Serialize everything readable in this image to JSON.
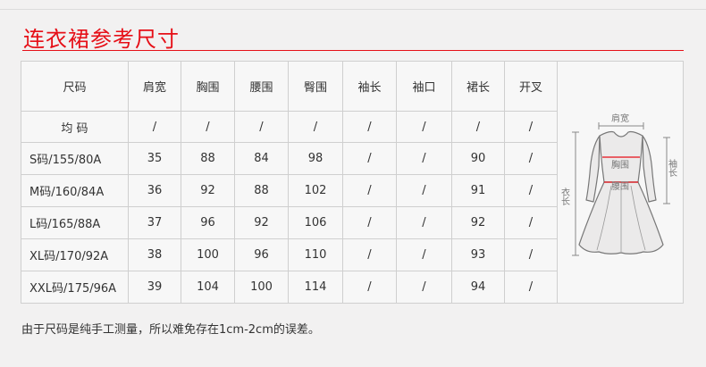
{
  "title": "连衣裙参考尺寸",
  "table": {
    "headers": [
      "尺码",
      "肩宽",
      "胸围",
      "腰围",
      "臀围",
      "袖长",
      "袖口",
      "裙长",
      "开叉"
    ],
    "rows": [
      [
        "均 码",
        "/",
        "/",
        "/",
        "/",
        "/",
        "/",
        "/",
        "/"
      ],
      [
        "S码/155/80A",
        "35",
        "88",
        "84",
        "98",
        "/",
        "/",
        "90",
        "/"
      ],
      [
        "M码/160/84A",
        "36",
        "92",
        "88",
        "102",
        "/",
        "/",
        "91",
        "/"
      ],
      [
        "L码/165/88A",
        "37",
        "96",
        "92",
        "106",
        "/",
        "/",
        "92",
        "/"
      ],
      [
        "XL码/170/92A",
        "38",
        "100",
        "96",
        "110",
        "/",
        "/",
        "93",
        "/"
      ],
      [
        "XXL码/175/96A",
        "39",
        "104",
        "100",
        "114",
        "/",
        "/",
        "94",
        "/"
      ]
    ]
  },
  "figure": {
    "shoulder_label": "肩宽",
    "chest_label": "胸围",
    "waist_label": "腰围",
    "sleeve_label": "袖长",
    "length_label": "衣长",
    "accent_color": "#e60f17"
  },
  "note": "由于尺码是纯手工测量，所以难免存在1cm-2cm的误差。"
}
